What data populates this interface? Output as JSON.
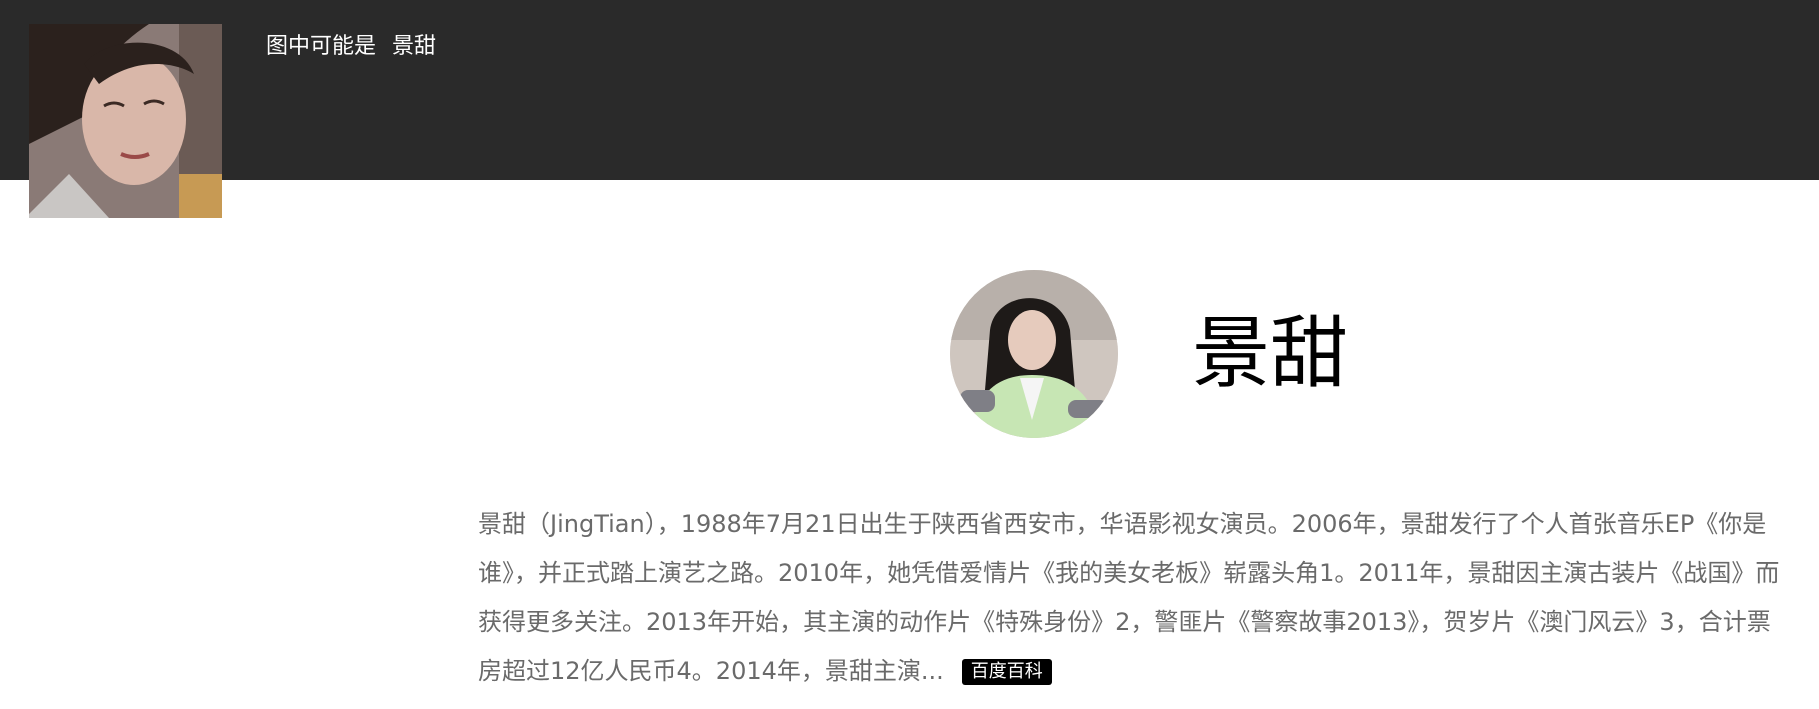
{
  "header": {
    "guess_label": "图中可能是",
    "guess_name": "景甜"
  },
  "result": {
    "name": "景甜",
    "description": "景甜（JingTian），1988年7月21日出生于陕西省西安市，华语影视女演员。2006年，景甜发行了个人首张音乐EP《你是谁》，并正式踏上演艺之路。2010年，她凭借爱情片《我的美女老板》崭露头角1。2011年，景甜因主演古装片《战国》而获得更多关注。2013年开始，其主演的动作片《特殊身份》2，警匪片《警察故事2013》，贺岁片《澳门风云》3，合计票房超过12亿人民币4。2014年，景甜主演...",
    "source_badge": "百度百科"
  },
  "colors": {
    "top_bar": "#2a2a2a",
    "name_text": "#000000",
    "body_text": "#6a6a6a",
    "badge_bg": "#000000"
  }
}
